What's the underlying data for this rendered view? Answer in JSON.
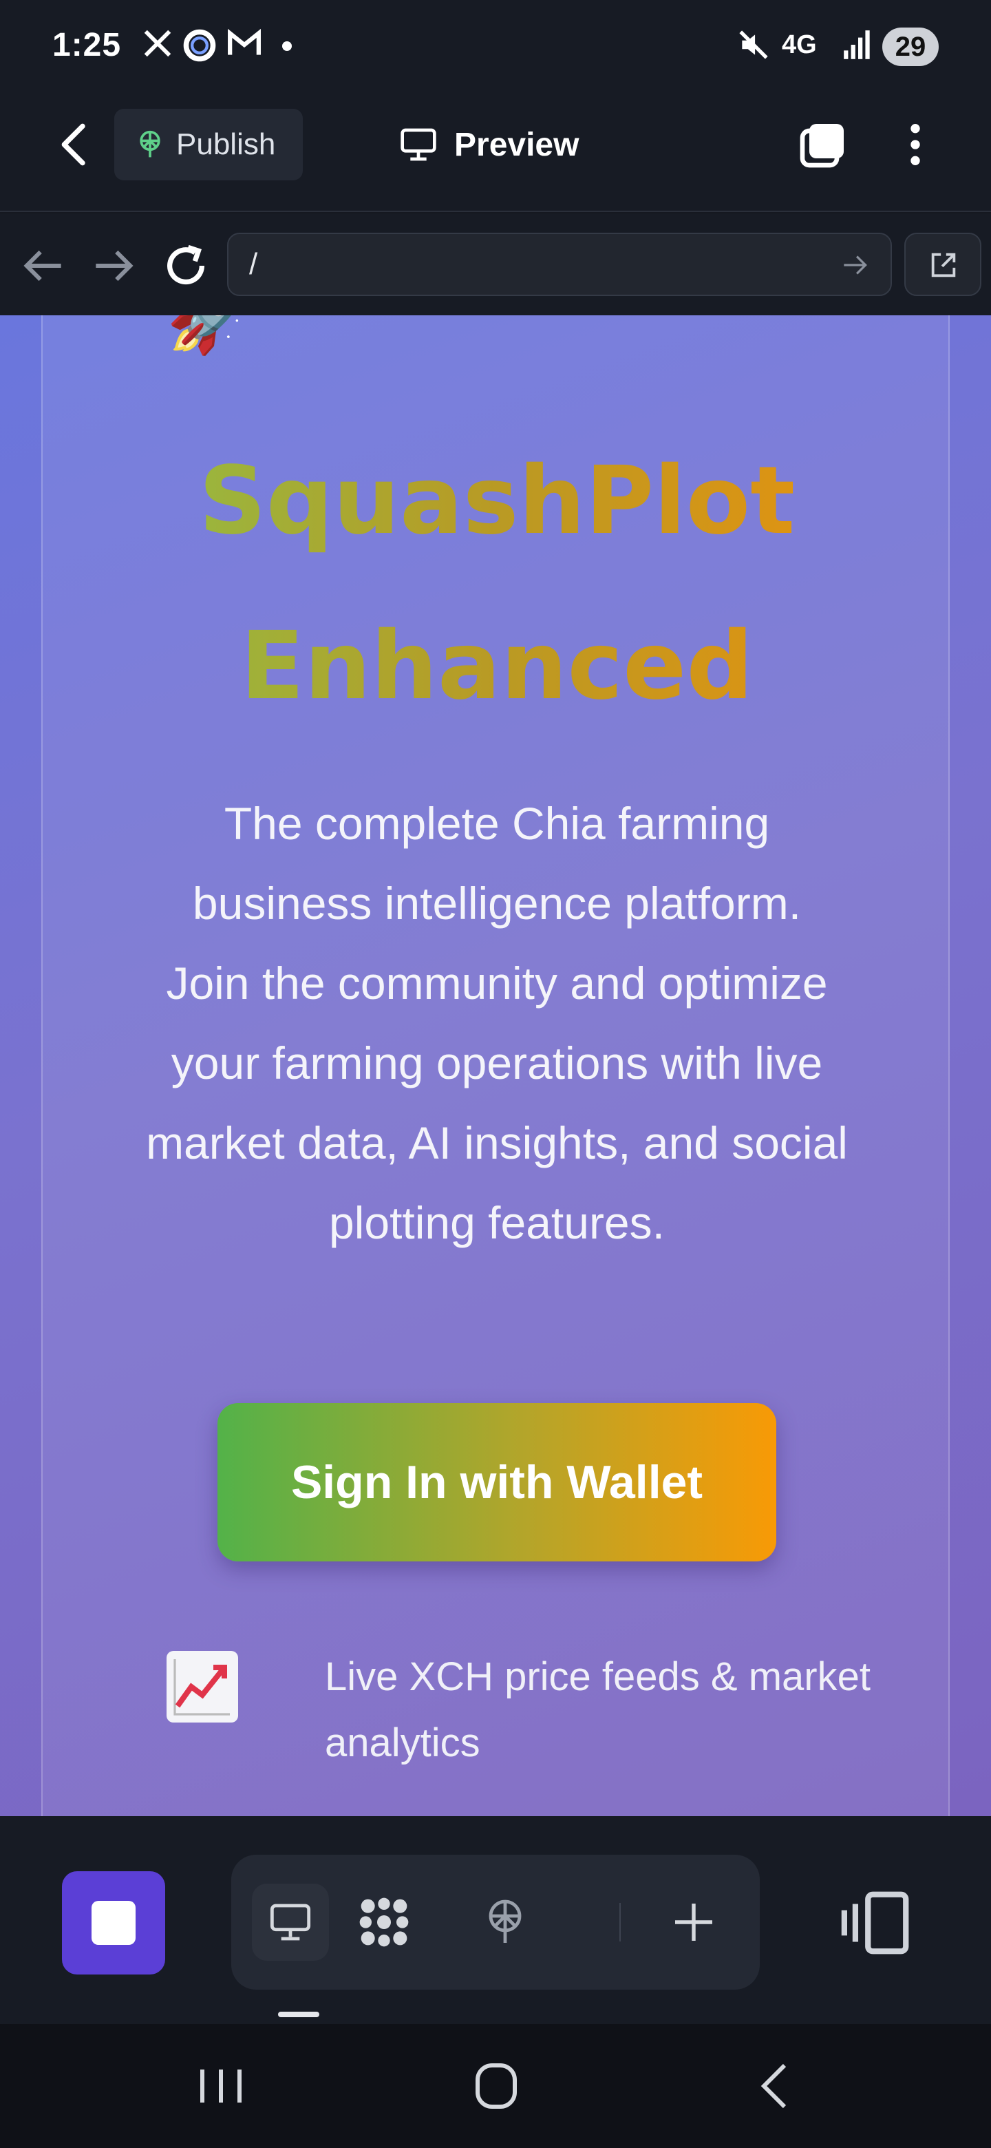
{
  "status_bar": {
    "time": "1:25",
    "battery": "29",
    "network": "4G"
  },
  "app_bar": {
    "publish_label": "Publish",
    "preview_label": "Preview"
  },
  "browser": {
    "url": "/"
  },
  "hero": {
    "emoji": "🚀",
    "title": "SquashPlot Enhanced",
    "description": "The complete Chia farming business intelligence platform. Join the community and optimize your farming operations with live market data, AI insights, and social plotting features.",
    "cta_label": "Sign In with Wallet",
    "features": [
      {
        "icon": "chart-increasing-icon",
        "text": "Live XCH price feeds & market analytics"
      }
    ]
  },
  "colors": {
    "accent": "#5b3fd6",
    "cta_start": "#53b249",
    "cta_end": "#f89a06",
    "background_start": "#6a76dd",
    "background_end": "#7b64c0"
  }
}
